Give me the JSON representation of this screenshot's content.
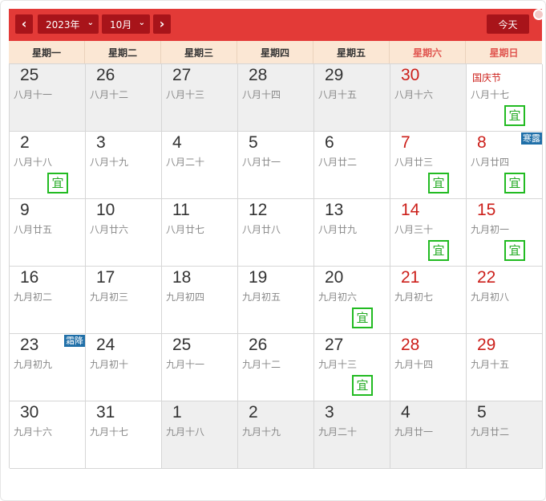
{
  "header": {
    "prev_label": "‹",
    "next_label": "›",
    "year_value": "2023年",
    "month_value": "10月",
    "today_label": "今天"
  },
  "weekdays": [
    "星期一",
    "星期二",
    "星期三",
    "星期四",
    "星期五",
    "星期六",
    "星期日"
  ],
  "days": [
    {
      "n": "25",
      "l": "八月十一",
      "other": true
    },
    {
      "n": "26",
      "l": "八月十二",
      "other": true
    },
    {
      "n": "27",
      "l": "八月十三",
      "other": true
    },
    {
      "n": "28",
      "l": "八月十四",
      "other": true
    },
    {
      "n": "29",
      "l": "八月十五",
      "other": true
    },
    {
      "n": "30",
      "l": "八月十六",
      "other": true,
      "red": true
    },
    {
      "n": "",
      "l": "八月十七",
      "h": "国庆节",
      "yi": true
    },
    {
      "n": "2",
      "l": "八月十八",
      "yi": true
    },
    {
      "n": "3",
      "l": "八月十九"
    },
    {
      "n": "4",
      "l": "八月二十"
    },
    {
      "n": "5",
      "l": "八月廿一"
    },
    {
      "n": "6",
      "l": "八月廿二"
    },
    {
      "n": "7",
      "l": "八月廿三",
      "red": true,
      "yi": true
    },
    {
      "n": "8",
      "l": "八月廿四",
      "red": true,
      "yi": true,
      "t": "寒露"
    },
    {
      "n": "9",
      "l": "八月廿五"
    },
    {
      "n": "10",
      "l": "八月廿六"
    },
    {
      "n": "11",
      "l": "八月廿七"
    },
    {
      "n": "12",
      "l": "八月廿八"
    },
    {
      "n": "13",
      "l": "八月廿九"
    },
    {
      "n": "14",
      "l": "八月三十",
      "red": true,
      "yi": true
    },
    {
      "n": "15",
      "l": "九月初一",
      "red": true,
      "yi": true
    },
    {
      "n": "16",
      "l": "九月初二"
    },
    {
      "n": "17",
      "l": "九月初三"
    },
    {
      "n": "18",
      "l": "九月初四"
    },
    {
      "n": "19",
      "l": "九月初五"
    },
    {
      "n": "20",
      "l": "九月初六",
      "yi": true
    },
    {
      "n": "21",
      "l": "九月初七",
      "red": true
    },
    {
      "n": "22",
      "l": "九月初八",
      "red": true
    },
    {
      "n": "23",
      "l": "九月初九",
      "t": "霜降"
    },
    {
      "n": "24",
      "l": "九月初十"
    },
    {
      "n": "25",
      "l": "九月十一"
    },
    {
      "n": "26",
      "l": "九月十二"
    },
    {
      "n": "27",
      "l": "九月十三",
      "yi": true
    },
    {
      "n": "28",
      "l": "九月十四",
      "red": true
    },
    {
      "n": "29",
      "l": "九月十五",
      "red": true
    },
    {
      "n": "30",
      "l": "九月十六"
    },
    {
      "n": "31",
      "l": "九月十七"
    },
    {
      "n": "1",
      "l": "九月十八",
      "other": true
    },
    {
      "n": "2",
      "l": "九月十九",
      "other": true
    },
    {
      "n": "3",
      "l": "九月二十",
      "other": true
    },
    {
      "n": "4",
      "l": "九月廿一",
      "other": true
    },
    {
      "n": "5",
      "l": "九月廿二",
      "other": true
    }
  ],
  "yi_label": "宜",
  "colors": {
    "header_bg": "#e33a37",
    "button_bg": "#a8141a",
    "weekday_bg": "#fbe7d4",
    "weekend_text": "#cc1f1a",
    "yi_green": "#22aa22",
    "solar_term_bg": "#1f6fa8"
  }
}
